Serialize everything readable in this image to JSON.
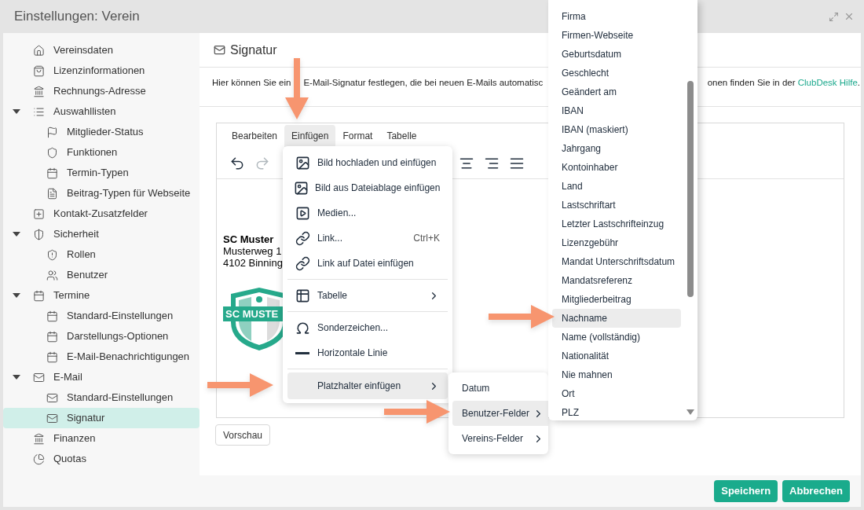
{
  "window": {
    "title": "Einstellungen: Verein"
  },
  "sidebar": {
    "items": [
      {
        "label": "Vereinsdaten",
        "selected": false
      },
      {
        "label": "Lizenzinformationen",
        "selected": false
      },
      {
        "label": "Rechnungs-Adresse",
        "selected": false
      },
      {
        "label": "Auswahllisten",
        "selected": false,
        "expanded": true,
        "children": [
          {
            "label": "Mitglieder-Status",
            "selected": false
          },
          {
            "label": "Funktionen",
            "selected": false
          },
          {
            "label": "Termin-Typen",
            "selected": false
          },
          {
            "label": "Beitrag-Typen für Webseite",
            "selected": false
          }
        ]
      },
      {
        "label": "Kontakt-Zusatzfelder",
        "selected": false
      },
      {
        "label": "Sicherheit",
        "selected": false,
        "expanded": true,
        "children": [
          {
            "label": "Rollen",
            "selected": false
          },
          {
            "label": "Benutzer",
            "selected": false
          }
        ]
      },
      {
        "label": "Termine",
        "selected": false,
        "expanded": true,
        "children": [
          {
            "label": "Standard-Einstellungen",
            "selected": false
          },
          {
            "label": "Darstellungs-Optionen",
            "selected": false
          },
          {
            "label": "E-Mail-Benachrichtigungen",
            "selected": false
          }
        ]
      },
      {
        "label": "E-Mail",
        "selected": false,
        "expanded": true,
        "children": [
          {
            "label": "Standard-Einstellungen",
            "selected": false
          },
          {
            "label": "Signatur",
            "selected": true
          }
        ]
      },
      {
        "label": "Finanzen",
        "selected": false
      },
      {
        "label": "Quotas",
        "selected": false
      }
    ]
  },
  "content": {
    "title": "Signatur",
    "description_start": "Hier können Sie ein",
    "description_middle": "E-Mail-Signatur festlegen, die bei neuen E-Mails automatisc",
    "description_end": "onen finden Sie in der ",
    "help_link": "ClubDesk Hilfe",
    "description_tail": ".",
    "editor": {
      "menus": [
        {
          "label": "Bearbeiten",
          "selected": false
        },
        {
          "label": "Einfügen",
          "selected": true
        },
        {
          "label": "Format",
          "selected": false
        },
        {
          "label": "Tabelle",
          "selected": false
        }
      ],
      "toolbar": [
        {
          "disabled": false
        },
        {
          "disabled": true
        },
        {
          "disabled": false
        },
        {
          "disabled": false
        },
        {
          "disabled": false
        }
      ],
      "signature": {
        "name": "SC Muster",
        "lines": [
          "Musterweg 1",
          "4102 Binning"
        ],
        "logo_text": "SC MUSTE"
      }
    },
    "preview_button": "Vorschau"
  },
  "insert_menu": {
    "groups": [
      [
        {
          "label": "Bild hochladen und einfügen",
          "selected": false
        },
        {
          "label": "Bild aus Dateiablage einfügen",
          "selected": false
        },
        {
          "label": "Medien...",
          "selected": false
        },
        {
          "label": "Link...",
          "shortcut": "Ctrl+K",
          "selected": false
        },
        {
          "label": "Link auf Datei einfügen",
          "selected": false
        }
      ],
      [
        {
          "label": "Tabelle",
          "submenu": true,
          "selected": false
        }
      ],
      [
        {
          "label": "Sonderzeichen...",
          "selected": false
        },
        {
          "label": "Horizontale Linie",
          "selected": false
        }
      ],
      [
        {
          "label": "Platzhalter einfügen",
          "submenu": true,
          "selected": true
        }
      ]
    ]
  },
  "placeholder_menu": {
    "items": [
      {
        "label": "Datum",
        "submenu": false,
        "selected": false
      },
      {
        "label": "Benutzer-Felder",
        "submenu": true,
        "selected": true
      },
      {
        "label": "Vereins-Felder",
        "submenu": true,
        "selected": false
      }
    ]
  },
  "field_list": {
    "items": [
      {
        "label": "Firma",
        "selected": false
      },
      {
        "label": "Firmen-Webseite",
        "selected": false
      },
      {
        "label": "Geburtsdatum",
        "selected": false
      },
      {
        "label": "Geschlecht",
        "selected": false
      },
      {
        "label": "Geändert am",
        "selected": false
      },
      {
        "label": "IBAN",
        "selected": false
      },
      {
        "label": "IBAN (maskiert)",
        "selected": false
      },
      {
        "label": "Jahrgang",
        "selected": false
      },
      {
        "label": "Kontoinhaber",
        "selected": false
      },
      {
        "label": "Land",
        "selected": false
      },
      {
        "label": "Lastschriftart",
        "selected": false
      },
      {
        "label": "Letzter Lastschrifteinzug",
        "selected": false
      },
      {
        "label": "Lizenzgebühr",
        "selected": false
      },
      {
        "label": "Mandat Unterschriftsdatum",
        "selected": false
      },
      {
        "label": "Mandatsreferenz",
        "selected": false
      },
      {
        "label": "Mitgliederbeitrag",
        "selected": false
      },
      {
        "label": "Nachname",
        "selected": true
      },
      {
        "label": "Name (vollständig)",
        "selected": false
      },
      {
        "label": "Nationalität",
        "selected": false
      },
      {
        "label": "Nie mahnen",
        "selected": false
      },
      {
        "label": "Ort",
        "selected": false
      },
      {
        "label": "PLZ",
        "selected": false
      }
    ]
  },
  "footer": {
    "buttons": [
      "Speichern",
      "Abbrechen"
    ]
  }
}
